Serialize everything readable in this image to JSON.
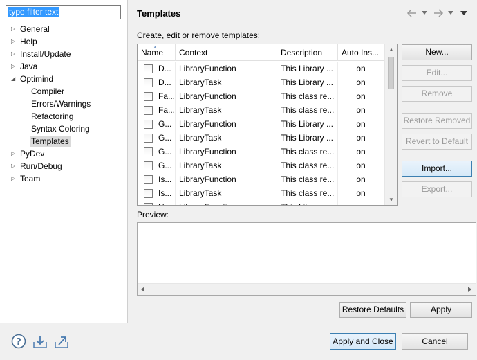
{
  "filter": {
    "value": "type filter text"
  },
  "tree": [
    {
      "label": "General",
      "expand": "right"
    },
    {
      "label": "Help",
      "expand": "right"
    },
    {
      "label": "Install/Update",
      "expand": "right"
    },
    {
      "label": "Java",
      "expand": "right"
    },
    {
      "label": "Optimind",
      "expand": "down"
    },
    {
      "label": "Compiler",
      "expand": "none"
    },
    {
      "label": "Errors/Warnings",
      "expand": "none"
    },
    {
      "label": "Refactoring",
      "expand": "none"
    },
    {
      "label": "Syntax Coloring",
      "expand": "none"
    },
    {
      "label": "Templates",
      "expand": "none",
      "selected": true
    },
    {
      "label": "PyDev",
      "expand": "right"
    },
    {
      "label": "Run/Debug",
      "expand": "right"
    },
    {
      "label": "Team",
      "expand": "right"
    }
  ],
  "page": {
    "title": "Templates",
    "description": "Create, edit or remove templates:",
    "preview_label": "Preview:"
  },
  "table": {
    "headers": [
      "Name",
      "Context",
      "Description",
      "Auto Ins..."
    ],
    "rows": [
      {
        "name": "D...",
        "context": "LibraryFunction",
        "description": "This Library ...",
        "auto": "on"
      },
      {
        "name": "D...",
        "context": "LibraryTask",
        "description": "This Library ...",
        "auto": "on"
      },
      {
        "name": "Fa...",
        "context": "LibraryFunction",
        "description": "This class re...",
        "auto": "on"
      },
      {
        "name": "Fa...",
        "context": "LibraryTask",
        "description": "This class re...",
        "auto": "on"
      },
      {
        "name": "G...",
        "context": "LibraryFunction",
        "description": "This Library ...",
        "auto": "on"
      },
      {
        "name": "G...",
        "context": "LibraryTask",
        "description": "This Library ...",
        "auto": "on"
      },
      {
        "name": "G...",
        "context": "LibraryFunction",
        "description": "This class re...",
        "auto": "on"
      },
      {
        "name": "G...",
        "context": "LibraryTask",
        "description": "This class re...",
        "auto": "on"
      },
      {
        "name": "Is...",
        "context": "LibraryFunction",
        "description": "This class re...",
        "auto": "on"
      },
      {
        "name": "Is...",
        "context": "LibraryTask",
        "description": "This class re...",
        "auto": "on"
      },
      {
        "name": "N...",
        "context": "LibraryFunction",
        "description": "This Library ...",
        "auto": "on"
      }
    ]
  },
  "buttons": {
    "new": "New...",
    "edit": "Edit...",
    "remove": "Remove",
    "restore_removed": "Restore Removed",
    "revert_default": "Revert to Default",
    "import": "Import...",
    "export": "Export...",
    "restore_defaults": "Restore Defaults",
    "apply": "Apply",
    "apply_close": "Apply and Close",
    "cancel": "Cancel"
  },
  "icons": {
    "back": "back-arrow-icon",
    "forward": "forward-arrow-icon",
    "menu": "view-menu-icon",
    "help": "help-icon",
    "import_prefs": "import-preferences-icon",
    "export_prefs": "export-preferences-icon"
  },
  "colors": {
    "selection": "#3399ff",
    "focus_border": "#3c7fb1"
  }
}
